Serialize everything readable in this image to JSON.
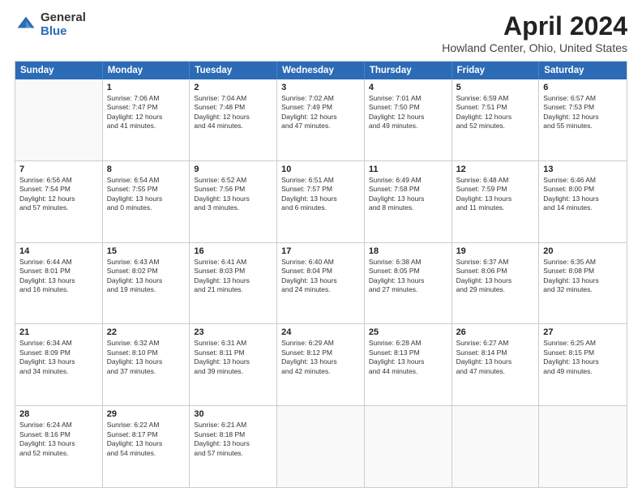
{
  "logo": {
    "general": "General",
    "blue": "Blue"
  },
  "title": "April 2024",
  "subtitle": "Howland Center, Ohio, United States",
  "header_days": [
    "Sunday",
    "Monday",
    "Tuesday",
    "Wednesday",
    "Thursday",
    "Friday",
    "Saturday"
  ],
  "weeks": [
    [
      {
        "day": "",
        "details": ""
      },
      {
        "day": "1",
        "details": "Sunrise: 7:06 AM\nSunset: 7:47 PM\nDaylight: 12 hours\nand 41 minutes."
      },
      {
        "day": "2",
        "details": "Sunrise: 7:04 AM\nSunset: 7:48 PM\nDaylight: 12 hours\nand 44 minutes."
      },
      {
        "day": "3",
        "details": "Sunrise: 7:02 AM\nSunset: 7:49 PM\nDaylight: 12 hours\nand 47 minutes."
      },
      {
        "day": "4",
        "details": "Sunrise: 7:01 AM\nSunset: 7:50 PM\nDaylight: 12 hours\nand 49 minutes."
      },
      {
        "day": "5",
        "details": "Sunrise: 6:59 AM\nSunset: 7:51 PM\nDaylight: 12 hours\nand 52 minutes."
      },
      {
        "day": "6",
        "details": "Sunrise: 6:57 AM\nSunset: 7:53 PM\nDaylight: 12 hours\nand 55 minutes."
      }
    ],
    [
      {
        "day": "7",
        "details": "Sunrise: 6:56 AM\nSunset: 7:54 PM\nDaylight: 12 hours\nand 57 minutes."
      },
      {
        "day": "8",
        "details": "Sunrise: 6:54 AM\nSunset: 7:55 PM\nDaylight: 13 hours\nand 0 minutes."
      },
      {
        "day": "9",
        "details": "Sunrise: 6:52 AM\nSunset: 7:56 PM\nDaylight: 13 hours\nand 3 minutes."
      },
      {
        "day": "10",
        "details": "Sunrise: 6:51 AM\nSunset: 7:57 PM\nDaylight: 13 hours\nand 6 minutes."
      },
      {
        "day": "11",
        "details": "Sunrise: 6:49 AM\nSunset: 7:58 PM\nDaylight: 13 hours\nand 8 minutes."
      },
      {
        "day": "12",
        "details": "Sunrise: 6:48 AM\nSunset: 7:59 PM\nDaylight: 13 hours\nand 11 minutes."
      },
      {
        "day": "13",
        "details": "Sunrise: 6:46 AM\nSunset: 8:00 PM\nDaylight: 13 hours\nand 14 minutes."
      }
    ],
    [
      {
        "day": "14",
        "details": "Sunrise: 6:44 AM\nSunset: 8:01 PM\nDaylight: 13 hours\nand 16 minutes."
      },
      {
        "day": "15",
        "details": "Sunrise: 6:43 AM\nSunset: 8:02 PM\nDaylight: 13 hours\nand 19 minutes."
      },
      {
        "day": "16",
        "details": "Sunrise: 6:41 AM\nSunset: 8:03 PM\nDaylight: 13 hours\nand 21 minutes."
      },
      {
        "day": "17",
        "details": "Sunrise: 6:40 AM\nSunset: 8:04 PM\nDaylight: 13 hours\nand 24 minutes."
      },
      {
        "day": "18",
        "details": "Sunrise: 6:38 AM\nSunset: 8:05 PM\nDaylight: 13 hours\nand 27 minutes."
      },
      {
        "day": "19",
        "details": "Sunrise: 6:37 AM\nSunset: 8:06 PM\nDaylight: 13 hours\nand 29 minutes."
      },
      {
        "day": "20",
        "details": "Sunrise: 6:35 AM\nSunset: 8:08 PM\nDaylight: 13 hours\nand 32 minutes."
      }
    ],
    [
      {
        "day": "21",
        "details": "Sunrise: 6:34 AM\nSunset: 8:09 PM\nDaylight: 13 hours\nand 34 minutes."
      },
      {
        "day": "22",
        "details": "Sunrise: 6:32 AM\nSunset: 8:10 PM\nDaylight: 13 hours\nand 37 minutes."
      },
      {
        "day": "23",
        "details": "Sunrise: 6:31 AM\nSunset: 8:11 PM\nDaylight: 13 hours\nand 39 minutes."
      },
      {
        "day": "24",
        "details": "Sunrise: 6:29 AM\nSunset: 8:12 PM\nDaylight: 13 hours\nand 42 minutes."
      },
      {
        "day": "25",
        "details": "Sunrise: 6:28 AM\nSunset: 8:13 PM\nDaylight: 13 hours\nand 44 minutes."
      },
      {
        "day": "26",
        "details": "Sunrise: 6:27 AM\nSunset: 8:14 PM\nDaylight: 13 hours\nand 47 minutes."
      },
      {
        "day": "27",
        "details": "Sunrise: 6:25 AM\nSunset: 8:15 PM\nDaylight: 13 hours\nand 49 minutes."
      }
    ],
    [
      {
        "day": "28",
        "details": "Sunrise: 6:24 AM\nSunset: 8:16 PM\nDaylight: 13 hours\nand 52 minutes."
      },
      {
        "day": "29",
        "details": "Sunrise: 6:22 AM\nSunset: 8:17 PM\nDaylight: 13 hours\nand 54 minutes."
      },
      {
        "day": "30",
        "details": "Sunrise: 6:21 AM\nSunset: 8:18 PM\nDaylight: 13 hours\nand 57 minutes."
      },
      {
        "day": "",
        "details": ""
      },
      {
        "day": "",
        "details": ""
      },
      {
        "day": "",
        "details": ""
      },
      {
        "day": "",
        "details": ""
      }
    ]
  ]
}
